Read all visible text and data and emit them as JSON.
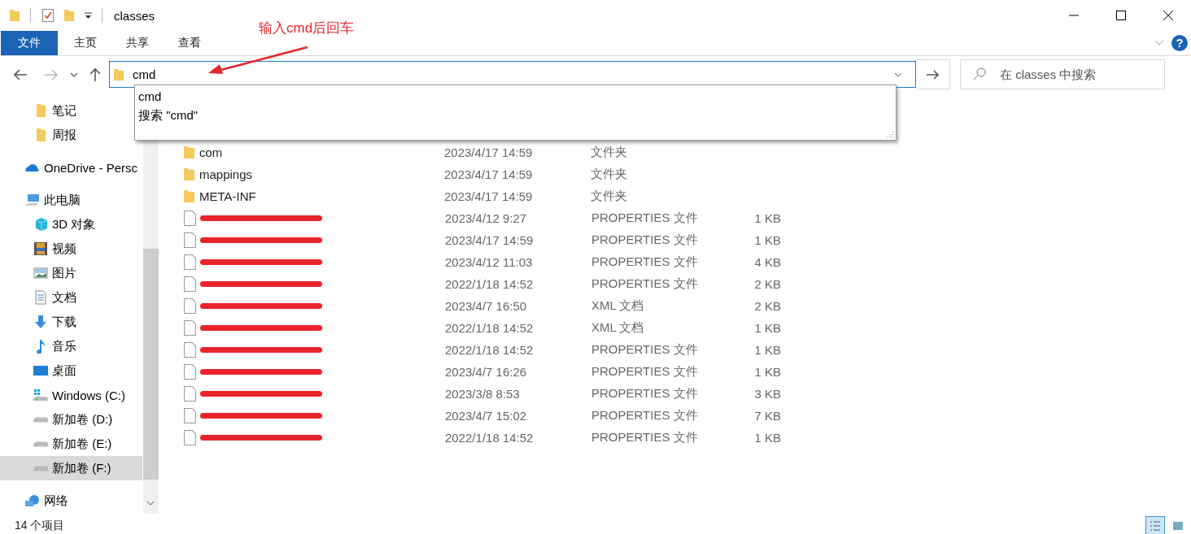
{
  "window": {
    "title": "classes"
  },
  "ribbon": {
    "tabs": [
      {
        "label": "文件",
        "selected": true
      },
      {
        "label": "主页",
        "selected": false
      },
      {
        "label": "共享",
        "selected": false
      },
      {
        "label": "查看",
        "selected": false
      }
    ],
    "help_label": "?"
  },
  "address": {
    "value": "cmd",
    "suggestions": [
      "cmd",
      "搜索 \"cmd\""
    ]
  },
  "search": {
    "placeholder": "在 classes 中搜索"
  },
  "annotation": {
    "text": "输入cmd后回车"
  },
  "sidebar": {
    "groups": [
      {
        "items": [
          {
            "label": "笔记",
            "kind": "folder",
            "selected": false
          },
          {
            "label": "周报",
            "kind": "folder",
            "selected": false
          }
        ]
      },
      {
        "items": [
          {
            "label": "OneDrive - Persc",
            "kind": "cloud",
            "selected": false
          }
        ]
      },
      {
        "items": [
          {
            "label": "此电脑",
            "kind": "pc",
            "selected": false,
            "children": [
              {
                "label": "3D 对象",
                "kind": "cube",
                "selected": false
              },
              {
                "label": "视频",
                "kind": "video",
                "selected": false
              },
              {
                "label": "图片",
                "kind": "image",
                "selected": false
              },
              {
                "label": "文档",
                "kind": "doc",
                "selected": false
              },
              {
                "label": "下载",
                "kind": "download",
                "selected": false
              },
              {
                "label": "音乐",
                "kind": "music",
                "selected": false
              },
              {
                "label": "桌面",
                "kind": "desktop",
                "selected": false
              },
              {
                "label": "Windows (C:)",
                "kind": "drive-win",
                "selected": false
              },
              {
                "label": "新加卷 (D:)",
                "kind": "drive",
                "selected": false
              },
              {
                "label": "新加卷 (E:)",
                "kind": "drive",
                "selected": false
              },
              {
                "label": "新加卷 (F:)",
                "kind": "drive",
                "selected": true
              }
            ]
          }
        ]
      },
      {
        "items": [
          {
            "label": "网络",
            "kind": "network",
            "selected": false
          }
        ]
      }
    ]
  },
  "files": [
    {
      "kind": "folder",
      "name": "com",
      "date": "2023/4/17 14:59",
      "type": "文件夹",
      "redacted": false
    },
    {
      "kind": "folder",
      "name": "mappings",
      "date": "2023/4/17 14:59",
      "type": "文件夹",
      "redacted": false
    },
    {
      "kind": "folder",
      "name": "META-INF",
      "date": "2023/4/17 14:59",
      "type": "文件夹",
      "redacted": false
    },
    {
      "kind": "file",
      "redacted": true,
      "date": "2023/4/12 9:27",
      "type": "PROPERTIES 文件",
      "size": "1 KB"
    },
    {
      "kind": "file",
      "redacted": true,
      "date": "2023/4/17 14:59",
      "type": "PROPERTIES 文件",
      "size": "1 KB"
    },
    {
      "kind": "file",
      "redacted": true,
      "date": "2023/4/12 11:03",
      "type": "PROPERTIES 文件",
      "size": "4 KB"
    },
    {
      "kind": "file",
      "redacted": true,
      "date": "2022/1/18 14:52",
      "type": "PROPERTIES 文件",
      "size": "2 KB"
    },
    {
      "kind": "file",
      "redacted": true,
      "date": "2023/4/7 16:50",
      "type": "XML 文档",
      "size": "2 KB"
    },
    {
      "kind": "file",
      "redacted": true,
      "date": "2022/1/18 14:52",
      "type": "XML 文档",
      "size": "1 KB"
    },
    {
      "kind": "file",
      "redacted": true,
      "date": "2022/1/18 14:52",
      "type": "PROPERTIES 文件",
      "size": "1 KB"
    },
    {
      "kind": "file",
      "redacted": true,
      "date": "2023/4/7 16:26",
      "type": "PROPERTIES 文件",
      "size": "1 KB"
    },
    {
      "kind": "file",
      "redacted": true,
      "date": "2023/3/8 8:53",
      "type": "PROPERTIES 文件",
      "size": "3 KB"
    },
    {
      "kind": "file",
      "redacted": true,
      "date": "2023/4/7 15:02",
      "type": "PROPERTIES 文件",
      "size": "7 KB"
    },
    {
      "kind": "file",
      "redacted": true,
      "date": "2022/1/18 14:52",
      "type": "PROPERTIES 文件",
      "size": "1 KB"
    }
  ],
  "status_bar": {
    "count": "14 个项目",
    "views": [
      {
        "kind": "details",
        "selected": true
      },
      {
        "kind": "icons",
        "selected": false
      }
    ]
  }
}
